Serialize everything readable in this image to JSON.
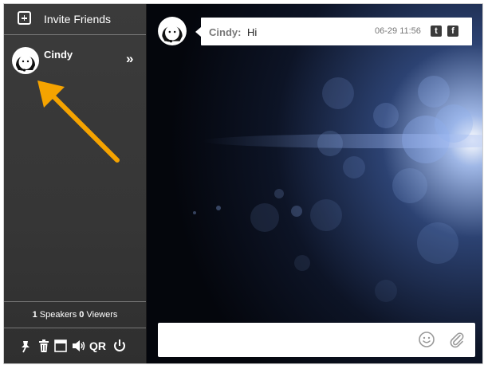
{
  "sidebar": {
    "invite_label": "Invite Friends",
    "user": {
      "name": "Cindy",
      "expand_glyph": "»"
    },
    "stats": {
      "speakers_count": "1",
      "speakers_label": "Speakers",
      "viewers_count": "0",
      "viewers_label": "Viewers"
    },
    "toolbar": {
      "qr_label": "QR",
      "icons": [
        "pin-icon",
        "trash-icon",
        "window-icon",
        "volume-icon",
        "qr-code",
        "power-icon"
      ]
    }
  },
  "chat": {
    "messages": [
      {
        "sender": "Cindy:",
        "text": "Hi",
        "time": "06-29 11:56",
        "share": [
          "t",
          "f"
        ]
      }
    ],
    "composer": {
      "value": "",
      "placeholder": ""
    }
  },
  "colors": {
    "sidebar_bg": "#383838",
    "chat_bg": "#050810",
    "annotation_arrow": "#f5a300"
  }
}
